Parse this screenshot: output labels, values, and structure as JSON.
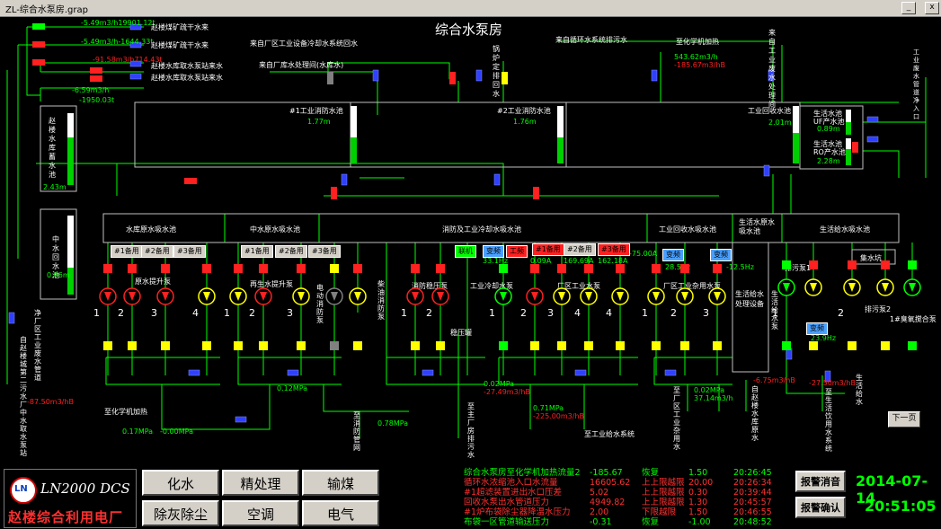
{
  "window": {
    "title": "ZL-综合水泵房.grap"
  },
  "page_title": "综合水泵房",
  "top_left": {
    "labels": [
      "赵楼煤矿疏干水来",
      "赵楼煤矿疏干水来",
      "赵楼水库取水泵站来水",
      "赵楼水库取水泵站来水"
    ],
    "readings": [
      "-5.49m3/h19901.12t",
      "-5.49m3/h-1644.33t",
      "-91.58m3/h714.43t",
      "-6.59m3/h",
      "-1950.03t"
    ]
  },
  "sources": {
    "factory_cooling": "来自厂区工业设备冷却水系统回水",
    "reservoir": "来自厂库水处理间(水库水)",
    "boiler": "锅炉定排回水",
    "circulation": "来自循环水系统排污水",
    "chem_flow_label": "至化学机加热",
    "chem_flow_1": "543.62m3/h",
    "chem_flow_2": "-185.67m3/hB",
    "industrial_waste": "来自工业废水处理间",
    "industrial_wastewater_pipe": "工业废水管道净入口"
  },
  "tanks": {
    "res_storage": {
      "name": "赵楼水库蓄水池",
      "level": "2.43m",
      "fill": 0.35
    },
    "mid_water": {
      "name": "中水回水池",
      "level": "0.96m",
      "fill": 0.3
    },
    "fire1": {
      "name": "#1工业消防水池",
      "level": "1.77m",
      "fill": 0.45
    },
    "fire2": {
      "name": "#2工业消防水池",
      "level": "1.76m",
      "fill": 0.45
    },
    "recovery": {
      "name": "工业回收水池",
      "level": "2.01m",
      "fill": 0.5
    },
    "uf": {
      "name": "生活水池UF产水池",
      "level": "0.89m",
      "fill": 0.3
    },
    "ro": {
      "name": "生活水池RO产水池",
      "level": "2.28m",
      "fill": 0.55
    }
  },
  "suction_bays": [
    "水库原水吸水池",
    "中水原水吸水池",
    "消防及工业冷却水吸水池",
    "工业回收水吸水池",
    "生活水原水吸水池",
    "生活给水吸水池"
  ],
  "mode_buttons": {
    "b1": "#1备用",
    "b2": "#2备用",
    "b3": "#3备用",
    "b4": "#1备用",
    "b5": "#2备用",
    "b6": "#3备用",
    "link": "联机",
    "freq": "变频",
    "work": "工频",
    "b7": "#1备用",
    "b8": "#2备用",
    "b9": "#3备用",
    "freq2": "变频",
    "freq3": "变频",
    "freq4": "变频"
  },
  "readouts": {
    "hz1": "33.1Hz",
    "a1": "0.09A",
    "a2": "169.69A",
    "a3": "162.18A",
    "a4": "-75.00A",
    "hz2": "28.5Hz",
    "hz3": "-12.5Hz",
    "hz4": "23.9Hz"
  },
  "pump_groups": {
    "raw_lift": "原水提升泵",
    "mid_lift": "再生水提升泵",
    "elec_fire": "电动消防泵",
    "diesel_fire": "柴油消防泵",
    "fire_stab": "消防稳压泵",
    "cooling": "工业冷却水泵",
    "ind_water": "厂区工业水泵",
    "ind_misc": "厂区工业杂用水泵",
    "drain1": "排污泵1",
    "drain2": "排污泵2",
    "collect_pit": "集水坑",
    "live_treat": "生活给水处理设备",
    "live_lift": "生活给水泵"
  },
  "pump_numbers": [
    "1",
    "2",
    "3",
    "4"
  ],
  "pressures": {
    "p1": "0.12MPa",
    "p2": "0.17MPa",
    "p3": "-0.00MPa",
    "p4": "0.78MPa",
    "p5": "0.02MPa",
    "p5b": "-27.49m3/hB",
    "p6": "0.71MPa",
    "p6b": "-225.00m3/hB",
    "p7": "0.02MPa",
    "p7b": "37.14m3/h",
    "p8": "-6.75m3/hB",
    "p9": "-27.50m3/hB"
  },
  "outlets": {
    "mid_intake": "自赵楼城第二污水厂中水取水泵站",
    "left_wastewater": "净厂区工业废水管道",
    "left_flow": "-87.50m3/hB",
    "chem_add": "至化学机加热",
    "fire_net": "至消防管网",
    "drainage": "至主厂房排污水",
    "ind_net": "至工业给水系统",
    "misc_net": "至厂区工业杂用水",
    "res_out": "自赵楼水库原水",
    "live_net": "至生活饮用水系统",
    "live_water": "生活给水",
    "reservoir_hex": "1#臭氧搅合泵",
    "pressurize": "稳压罐"
  },
  "next_page": "下一页",
  "bottom": {
    "product": "LN2000 DCS",
    "logo_mark": "LN",
    "plant": "赵楼综合利用电厂",
    "nav": [
      "化水",
      "精处理",
      "输煤",
      "除灰除尘",
      "空调",
      "电气"
    ],
    "alarms": [
      {
        "text": "综合水泵房至化学机加热流量2",
        "value": "-185.67",
        "state": "恢复",
        "limit": "1.50",
        "time": "20:26:45",
        "color": "#00ff00"
      },
      {
        "text": "循环水浓缩池入口水流量",
        "value": "16605.62",
        "state": "上上限越限",
        "limit": "20.00",
        "time": "20:26:34",
        "color": "#ff3030"
      },
      {
        "text": "#1超滤装置进出水口压差",
        "value": "5.02",
        "state": "上上限越限",
        "limit": "0.30",
        "time": "20:39:44",
        "color": "#ff3030"
      },
      {
        "text": "回收水泵出水管道压力",
        "value": "4949.82",
        "state": "上上限越限",
        "limit": "1.30",
        "time": "20:45:57",
        "color": "#ff3030"
      },
      {
        "text": "#1炉布袋除尘器降温水压力",
        "value": "2.00",
        "state": "下限越限",
        "limit": "1.50",
        "time": "20:46:55",
        "color": "#ff3030"
      },
      {
        "text": "布袋一区管道输送压力",
        "value": "-0.31",
        "state": "恢复",
        "limit": "-1.00",
        "time": "20:48:52",
        "color": "#00ff00"
      }
    ],
    "alarm_buttons": [
      "报警消音",
      "报警确认"
    ],
    "date": "2014-07-14",
    "time": "20:51:05"
  },
  "colors": {
    "pipe": "#00ff00",
    "running": "#00ff00",
    "stopped": "#ff2020",
    "standby": "#ffff00",
    "flowmeter": "#3a50ff"
  }
}
